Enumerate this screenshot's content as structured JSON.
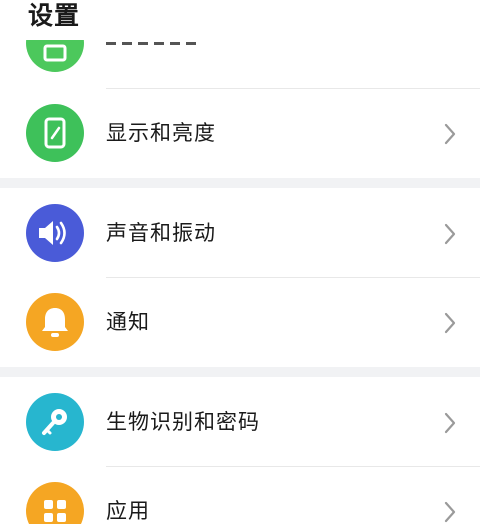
{
  "header": {
    "title": "设置"
  },
  "items": [
    {
      "label": "",
      "icon": "wallpaper-icon",
      "color": "#4cc85c"
    },
    {
      "label": "显示和亮度",
      "icon": "phone-display-icon",
      "color": "#3ec15a"
    },
    {
      "label": "声音和振动",
      "icon": "speaker-icon",
      "color": "#4a5bd8"
    },
    {
      "label": "通知",
      "icon": "bell-icon",
      "color": "#f5a623"
    },
    {
      "label": "生物识别和密码",
      "icon": "key-icon",
      "color": "#27b6cf"
    },
    {
      "label": "应用",
      "icon": "apps-grid-icon",
      "color": "#f5a623"
    }
  ],
  "colors": {
    "section_gap": "#f1f2f4",
    "divider": "#e8e8e8",
    "chevron": "#9a9a9a"
  }
}
